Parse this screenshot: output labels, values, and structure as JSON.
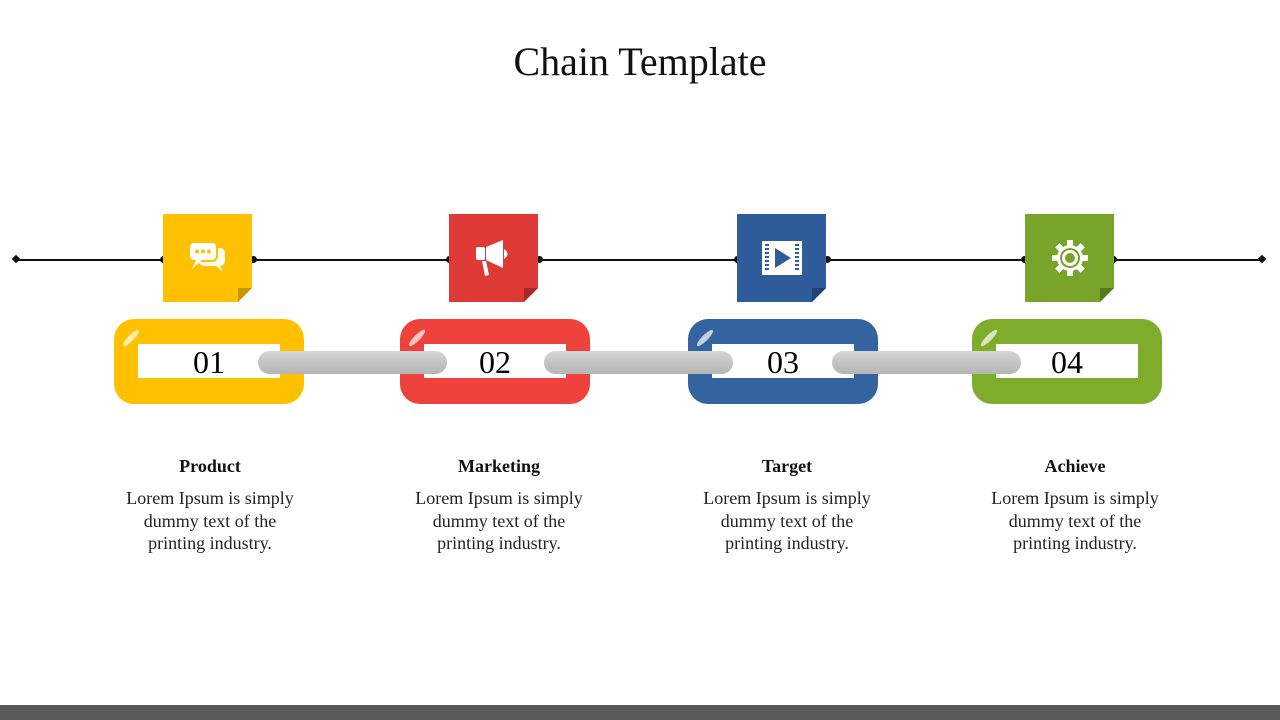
{
  "title": "Chain Template",
  "colors": {
    "yellow": "#FFC000",
    "red": "#E84040",
    "blue": "#2F5D9B",
    "green": "#78A42A",
    "footer": "#595959"
  },
  "steps": [
    {
      "number": "01",
      "heading": "Product",
      "description": "Lorem Ipsum is simply dummy text of the printing industry.",
      "icon": "chat-bubbles-icon",
      "color": "#FFC000"
    },
    {
      "number": "02",
      "heading": "Marketing",
      "description": "Lorem Ipsum is simply dummy text of the printing industry.",
      "icon": "megaphone-icon",
      "color": "#E84040"
    },
    {
      "number": "03",
      "heading": "Target",
      "description": "Lorem Ipsum is simply dummy text of the printing industry.",
      "icon": "video-play-icon",
      "color": "#2F5D9B"
    },
    {
      "number": "04",
      "heading": "Achieve",
      "description": "Lorem Ipsum is simply dummy text of the printing industry.",
      "icon": "gear-icon",
      "color": "#78A42A"
    }
  ]
}
